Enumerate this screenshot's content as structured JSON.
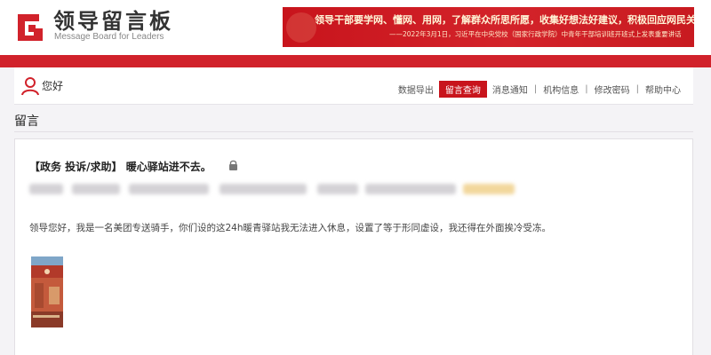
{
  "header": {
    "title": "领导留言板",
    "subtitle": "Message Board for Leaders",
    "banner_line1": "领导干部要学网、懂网、用网，了解群众所思所愿，收集好想法好建议，积极回应网民关切。",
    "banner_line2": "——2022年3月1日，习近平在中央党校（国家行政学院）中青年干部培训班开班式上发表重要讲话"
  },
  "nav": {
    "greeting": "您好",
    "items": [
      {
        "label": "数据导出"
      },
      {
        "label": "留言查询",
        "active": true
      },
      {
        "label": "消息通知"
      },
      {
        "label": "机构信息"
      },
      {
        "label": "修改密码"
      },
      {
        "label": "帮助中心"
      }
    ]
  },
  "section": {
    "title": "留言"
  },
  "message": {
    "title": "【政务 投诉/求助】 暖心驿站进不去。",
    "body": "领导您好，我是一名美团专送骑手，你们设的这24h暖青驿站我无法进入休息，设置了等于形同虚设，我还得在外面挨冷受冻。"
  },
  "colors": {
    "brand_red": "#d1222b",
    "active_nav": "#c8141c",
    "page_bg": "#f4f3f6"
  }
}
